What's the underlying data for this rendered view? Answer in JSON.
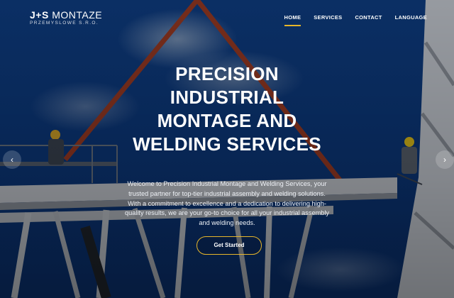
{
  "logo": {
    "brand_bold": "J+S",
    "brand_rest": " MONTAZE",
    "tagline": "PRZEMYSLOWE S.R.O."
  },
  "nav": {
    "items": [
      {
        "label": "HOME",
        "active": true
      },
      {
        "label": "SERVICES",
        "active": false
      },
      {
        "label": "CONTACT",
        "active": false
      },
      {
        "label": "LANGUAGE",
        "active": false
      }
    ]
  },
  "hero": {
    "title_lines": [
      "PRECISION",
      "INDUSTRIAL",
      "MONTAGE AND",
      "WELDING SERVICES"
    ],
    "description": "Welcome to Precision Industrial Montage and Welding Services, your trusted partner for top-tier industrial assembly and welding solutions. With a commitment to excellence and a dedication to delivering high-quality results, we are your go-to choice for all your industrial assembly and welding needs.",
    "cta_label": "Get Started"
  },
  "carousel": {
    "prev_icon": "chevron-left-icon",
    "next_icon": "chevron-right-icon",
    "prev_glyph": "‹",
    "next_glyph": "›"
  },
  "colors": {
    "accent": "#e7b62a",
    "sky": "#0c3a80"
  }
}
